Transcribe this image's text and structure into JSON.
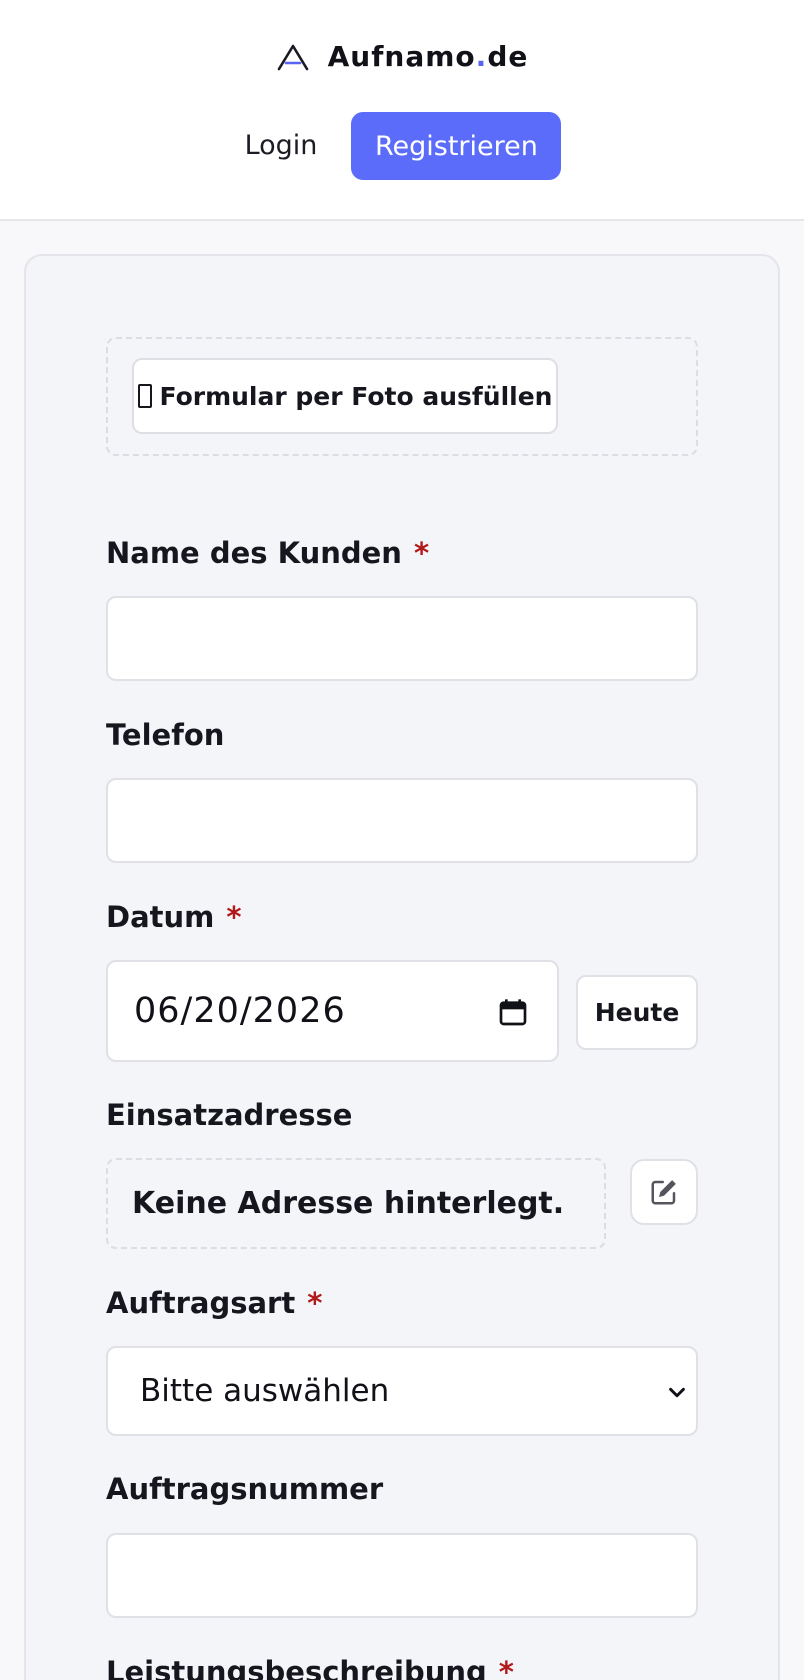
{
  "header": {
    "brand": {
      "name": "Aufnamo",
      "dot": ".",
      "tld": "de"
    },
    "login_label": "Login",
    "register_label": "Registrieren"
  },
  "photo_fill": {
    "label": "Formular per Foto ausfüllen"
  },
  "form": {
    "customer_name": {
      "label": "Name des Kunden",
      "required": "*",
      "value": ""
    },
    "phone": {
      "label": "Telefon",
      "value": ""
    },
    "date": {
      "label": "Datum",
      "required": "*",
      "value": "06/20/2026",
      "today_label": "Heute"
    },
    "address": {
      "label": "Einsatzadresse",
      "value": "Keine Adresse hinterlegt."
    },
    "order_type": {
      "label": "Auftragsart",
      "required": "*",
      "selected": "Bitte auswählen"
    },
    "order_number": {
      "label": "Auftragsnummer",
      "value": ""
    },
    "service_description": {
      "label": "Leistungsbeschreibung",
      "required": "*"
    }
  },
  "icons": {
    "logo": "logo-icon",
    "camera": "camera-icon",
    "calendar": "calendar-icon",
    "edit": "edit-icon",
    "chevron": "chevron-down-icon"
  },
  "colors": {
    "accent": "#5c6cfa",
    "required": "#b01a1a",
    "logo_dot": "#5865f2"
  }
}
